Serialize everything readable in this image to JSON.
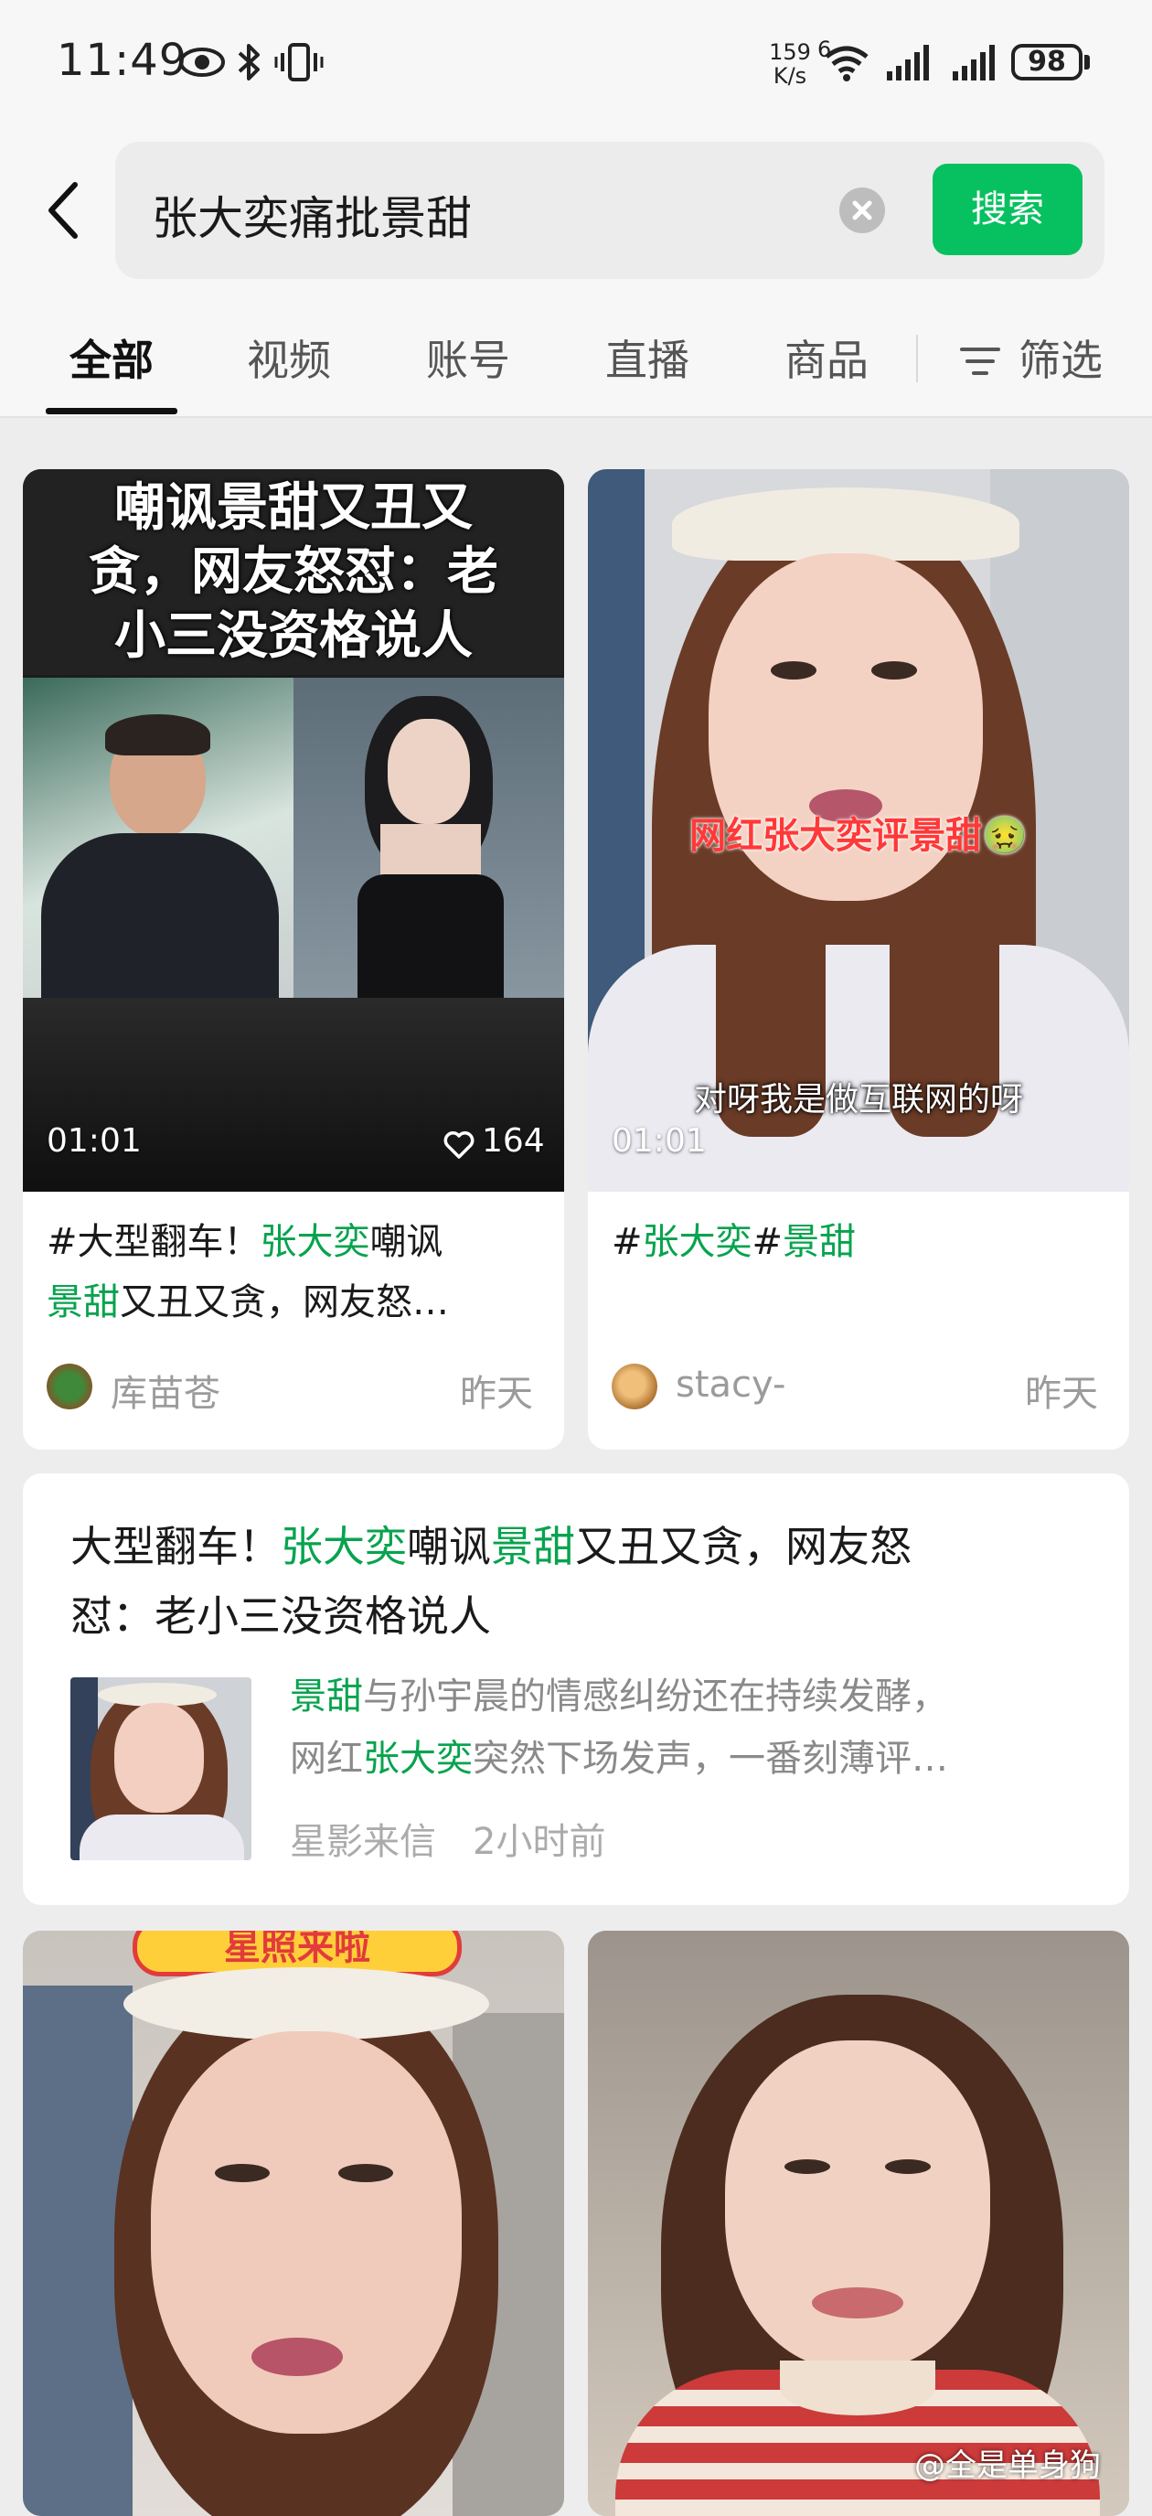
{
  "status_bar": {
    "time": "11:49",
    "net_speed_value": "159",
    "net_speed_unit": "K/s",
    "net_type": "6",
    "battery": "98"
  },
  "search": {
    "query": "张大奕痛批景甜",
    "button_label": "搜索"
  },
  "tabs": [
    {
      "label": "全部",
      "active": true
    },
    {
      "label": "视频",
      "active": false
    },
    {
      "label": "账号",
      "active": false
    },
    {
      "label": "直播",
      "active": false
    },
    {
      "label": "商品",
      "active": false
    }
  ],
  "filter_label": "筛选",
  "cards": [
    {
      "overlay_title_line1": "嘲讽景甜又丑又",
      "overlay_title_line2": "贪，网友怒怼：老",
      "overlay_title_line3": "小三没资格说人",
      "duration": "01:01",
      "likes": "164",
      "title_prefix": "#大型翻车！",
      "title_hl1": "张大奕",
      "title_mid": "嘲讽",
      "title_hl2": "景甜",
      "title_suffix": "又丑又贪，网友怒…",
      "author": "库苗苍",
      "time": "昨天"
    },
    {
      "overlay_caption": "网红张大奕评景甜🤢",
      "overlay_subtitle": "对呀我是做互联网的呀",
      "duration": "01:01",
      "title_hash1": "#",
      "title_hl1": "张大奕",
      "title_hash2": "#",
      "title_hl2": "景甜",
      "author": "stacy-",
      "time": "昨天"
    }
  ],
  "article": {
    "title_prefix": "大型翻车！",
    "title_hl1": "张大奕",
    "title_mid": "嘲讽",
    "title_hl2": "景甜",
    "title_suffix1": "又丑又贪，网友怒",
    "title_line2": "怼：老小三没资格说人",
    "excerpt_hl1": "景甜",
    "excerpt_rest1": "与孙宇晨的情感纠纷还在持续发酵，",
    "excerpt_pre2": "网红",
    "excerpt_hl2": "张大奕",
    "excerpt_rest2": "突然下场发声，一番刻薄评…",
    "source": "星影来信",
    "time": "2小时前"
  },
  "bottom_cards": [
    {
      "banner_text": "星照来啦"
    },
    {}
  ],
  "watermark": "@全是单身狗",
  "colors": {
    "accent": "#07c160",
    "highlight": "#07a34e"
  }
}
